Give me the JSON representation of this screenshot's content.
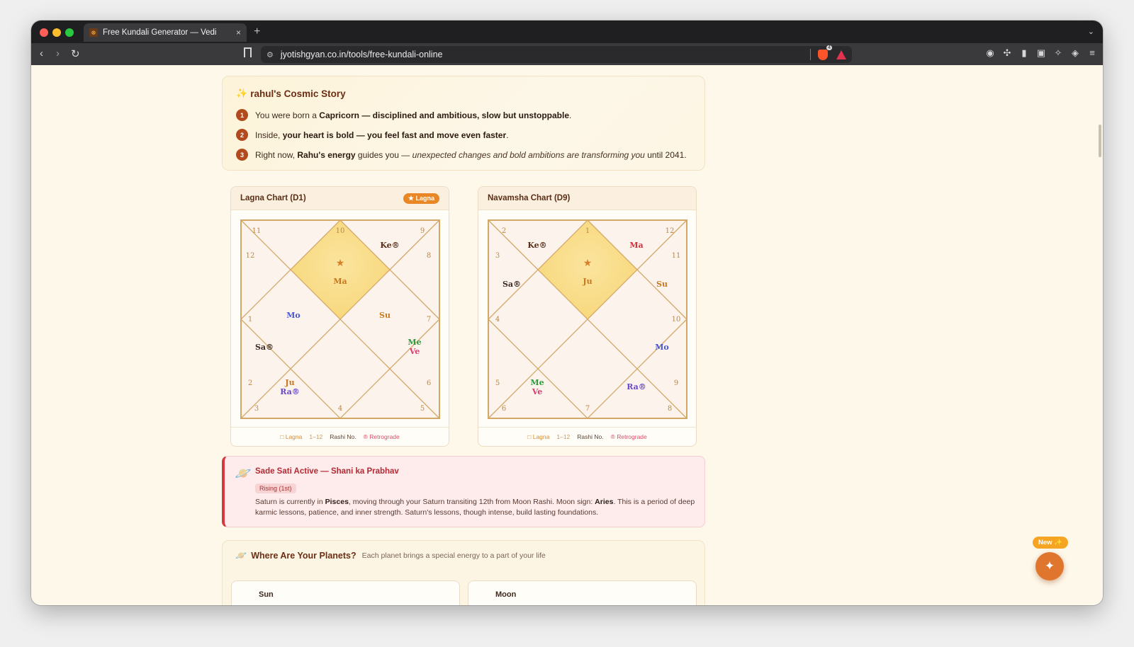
{
  "browser": {
    "tab_title": "Free Kundali Generator — Vedi",
    "tab_close": "×",
    "new_tab": "+",
    "url": "jyotishgyan.co.in/tools/free-kundali-online"
  },
  "story": {
    "title": "rahul's Cosmic Story",
    "rows": [
      {
        "num": "1",
        "parts": [
          {
            "t": "You were born a "
          },
          {
            "t": "Capricorn",
            "b": true
          },
          {
            "t": " "
          },
          {
            "t": "— disciplined and ambitious, slow but unstoppable",
            "b": true
          },
          {
            "t": "."
          }
        ]
      },
      {
        "num": "2",
        "parts": [
          {
            "t": "Inside, "
          },
          {
            "t": "your heart is bold — you feel fast and move even faster",
            "b": true
          },
          {
            "t": "."
          }
        ]
      },
      {
        "num": "3",
        "parts": [
          {
            "t": "Right now, "
          },
          {
            "t": "Rahu's energy",
            "b": true
          },
          {
            "t": " guides you — "
          },
          {
            "t": "unexpected changes and bold ambitions are transforming you",
            "i": true
          },
          {
            "t": " until 2041."
          }
        ]
      }
    ]
  },
  "charts": [
    {
      "title": "Lagna Chart (D1)",
      "badge": "★ Lagna",
      "houses": [
        "10",
        "9",
        "8",
        "7",
        "6",
        "5",
        "4",
        "3",
        "2",
        "1",
        "12",
        "11"
      ],
      "center_planets": [
        "Ma"
      ],
      "planets": [
        {
          "label": "Ke®",
          "color": "#5a2d16"
        },
        {
          "label": "Mo",
          "color": "#4a58d6"
        },
        {
          "label": "Su",
          "color": "#c8771e"
        },
        {
          "label": "Sa®",
          "color": "#3a2a22"
        },
        {
          "label": "Me",
          "color": "#2f9a3f"
        },
        {
          "label": "Ve",
          "color": "#d93d70"
        },
        {
          "label": "Ju",
          "color": "#c8771e"
        },
        {
          "label": "Ra®",
          "color": "#6a46c9"
        }
      ]
    },
    {
      "title": "Navamsha Chart (D9)",
      "badge": "",
      "houses": [
        "1",
        "12",
        "11",
        "10",
        "9",
        "8",
        "7",
        "6",
        "5",
        "4",
        "3",
        "2"
      ],
      "center_planets": [
        "Ju"
      ],
      "planets": [
        {
          "label": "Ke®",
          "color": "#5a2d16"
        },
        {
          "label": "Ma",
          "color": "#d5313c"
        },
        {
          "label": "Sa®",
          "color": "#3a2a22"
        },
        {
          "label": "Su",
          "color": "#c8771e"
        },
        {
          "label": "Mo",
          "color": "#4a58d6"
        },
        {
          "label": "Me",
          "color": "#2f9a3f"
        },
        {
          "label": "Ve",
          "color": "#d93d70"
        },
        {
          "label": "Ra®",
          "color": "#6a46c9"
        }
      ]
    }
  ],
  "legend": {
    "lagna": "□ Lagna",
    "range": "1–12",
    "rashi": "Rashi No.",
    "retro": "® Retrograde"
  },
  "sade_sati": {
    "title": "Sade Sati Active — Shani ka Prabhav",
    "badge": "Rising (1st)",
    "parts": [
      {
        "t": "Saturn is currently in "
      },
      {
        "t": "Pisces",
        "b": true
      },
      {
        "t": ", moving through your Saturn transiting 12th from Moon Rashi. Moon sign: "
      },
      {
        "t": "Aries",
        "b": true
      },
      {
        "t": ". This is a period of deep karmic lessons, patience, and inner strength. Saturn's lessons, though intense, build lasting foundations."
      }
    ]
  },
  "planets_section": {
    "title": "Where Are Your Planets?",
    "subtitle": "Each planet brings a special energy to a part of your life",
    "cards": [
      "Sun",
      "Moon"
    ]
  },
  "fab": {
    "new_label": "New ✨"
  },
  "colors": {
    "accent": "#e0752d",
    "brand_brown": "#6b2e14",
    "alert_red": "#d7373f"
  }
}
